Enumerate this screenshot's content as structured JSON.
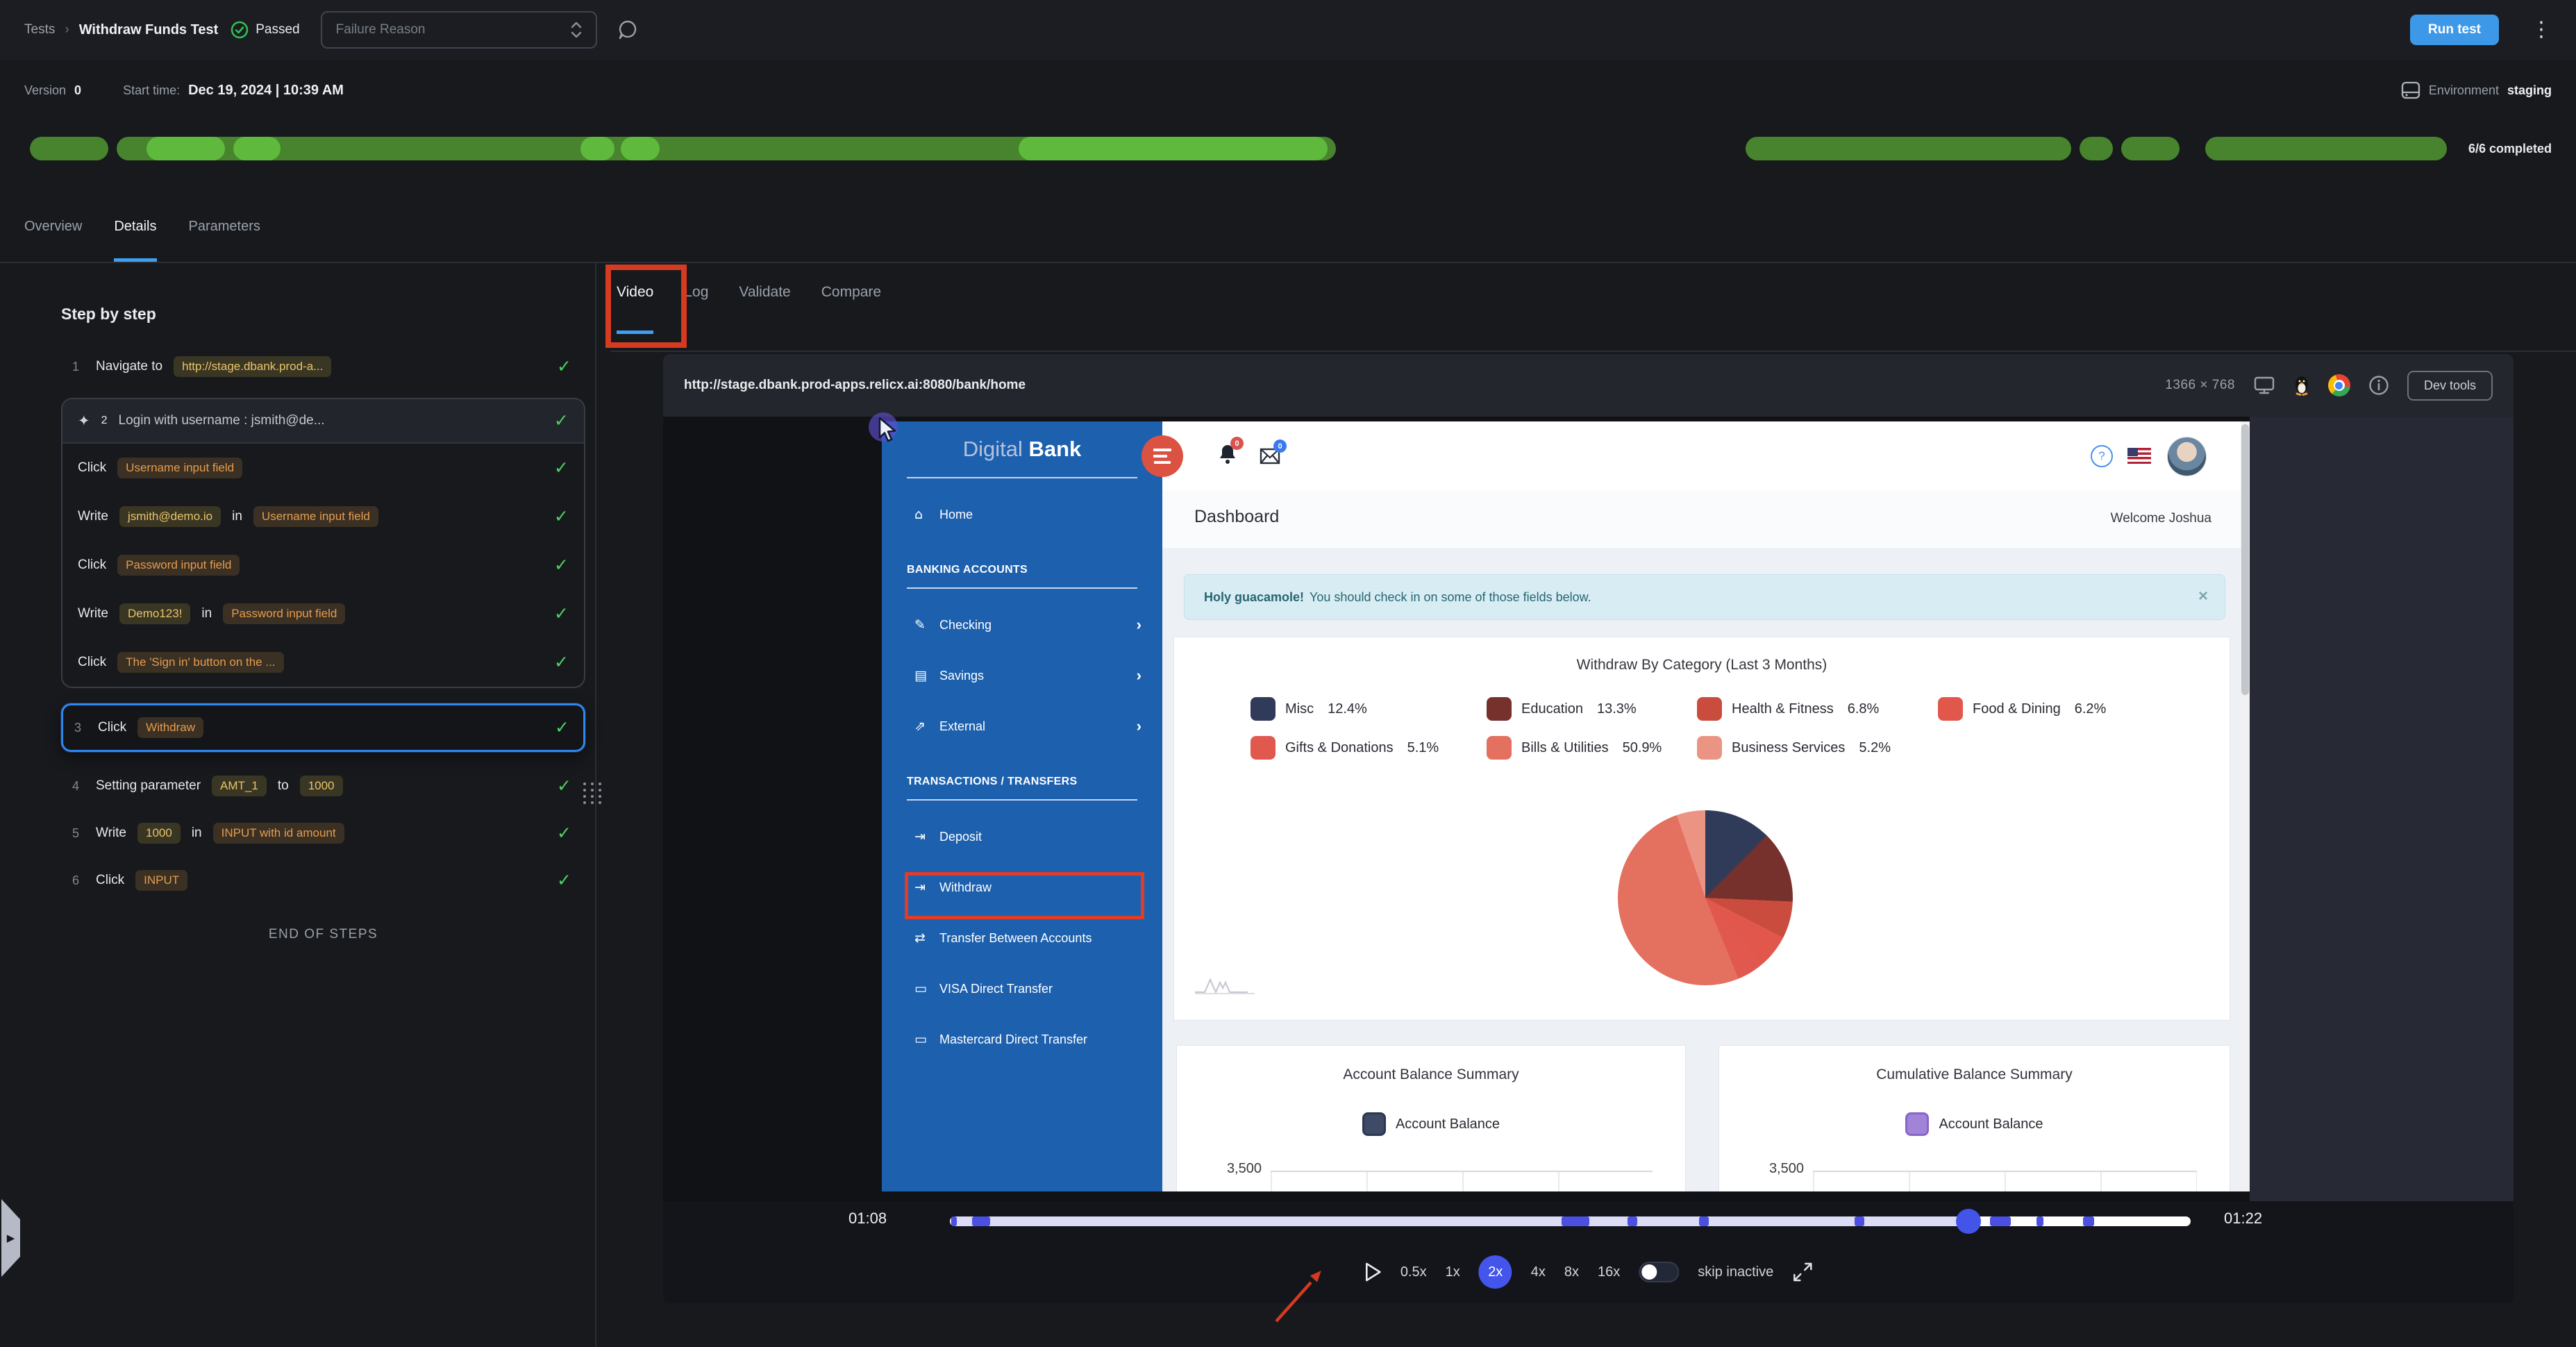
{
  "header": {
    "breadcrumb_root": "Tests",
    "breadcrumb_sep": "›",
    "title": "Withdraw Funds Test",
    "status": "Passed",
    "failure_reason_placeholder": "Failure Reason",
    "run_button": "Run test"
  },
  "meta": {
    "version_label": "Version",
    "version": "0",
    "start_label": "Start time:",
    "start_value": "Dec 19, 2024 | 10:39 AM",
    "environment_label": "Environment",
    "environment": "staging",
    "completed": "6/6 completed"
  },
  "progress": {
    "color_dark": "#47842d",
    "color_bright": "#5fb93c",
    "segments": [
      {
        "x": 0.0023,
        "w": 0.0323
      },
      {
        "x": 0.0381,
        "w": 0.502
      },
      {
        "x": 0.7087,
        "w": 0.134
      },
      {
        "x": 0.8462,
        "w": 0.0137
      },
      {
        "x": 0.8634,
        "w": 0.0241
      },
      {
        "x": 0.898,
        "w": 0.0994
      }
    ],
    "highlights": [
      {
        "x": 0.0503,
        "w": 0.0323
      },
      {
        "x": 0.086,
        "w": 0.0195
      },
      {
        "x": 0.2291,
        "w": 0.014
      },
      {
        "x": 0.2456,
        "w": 0.016
      },
      {
        "x": 0.4093,
        "w": 0.1273
      }
    ]
  },
  "main_tabs": [
    {
      "label": "Overview",
      "active": false
    },
    {
      "label": "Details",
      "active": true
    },
    {
      "label": "Parameters",
      "active": false
    }
  ],
  "steps_panel": {
    "heading": "Step by step",
    "end_label": "END OF STEPS",
    "steps": [
      {
        "type": "step",
        "num": "1",
        "check": true,
        "parts": [
          {
            "k": "t",
            "v": "Navigate to"
          },
          {
            "k": "y",
            "v": "http://stage.dbank.prod-a..."
          }
        ]
      },
      {
        "type": "group",
        "num": "2",
        "check": true,
        "header": "Login with username : jsmith@de...",
        "children": [
          {
            "check": true,
            "parts": [
              {
                "k": "t",
                "v": "Click"
              },
              {
                "k": "o",
                "v": "Username input field"
              }
            ]
          },
          {
            "check": true,
            "parts": [
              {
                "k": "t",
                "v": "Write"
              },
              {
                "k": "y",
                "v": "jsmith@demo.io"
              },
              {
                "k": "t",
                "v": "in"
              },
              {
                "k": "o",
                "v": "Username input field"
              }
            ]
          },
          {
            "check": true,
            "parts": [
              {
                "k": "t",
                "v": "Click"
              },
              {
                "k": "o",
                "v": "Password input field"
              }
            ]
          },
          {
            "check": true,
            "parts": [
              {
                "k": "t",
                "v": "Write"
              },
              {
                "k": "y",
                "v": "Demo123!"
              },
              {
                "k": "t",
                "v": "in"
              },
              {
                "k": "o",
                "v": "Password input field"
              }
            ]
          },
          {
            "check": true,
            "parts": [
              {
                "k": "t",
                "v": "Click"
              },
              {
                "k": "o",
                "v": "The 'Sign in' button on the ..."
              }
            ]
          }
        ]
      },
      {
        "type": "step",
        "num": "3",
        "selected": true,
        "check": true,
        "parts": [
          {
            "k": "t",
            "v": "Click"
          },
          {
            "k": "o",
            "v": "Withdraw"
          }
        ]
      },
      {
        "type": "step",
        "num": "4",
        "check": true,
        "parts": [
          {
            "k": "t",
            "v": "Setting parameter"
          },
          {
            "k": "y",
            "v": "AMT_1"
          },
          {
            "k": "t",
            "v": "to"
          },
          {
            "k": "y",
            "v": "1000"
          }
        ]
      },
      {
        "type": "step",
        "num": "5",
        "check": true,
        "parts": [
          {
            "k": "t",
            "v": "Write"
          },
          {
            "k": "y",
            "v": "1000"
          },
          {
            "k": "t",
            "v": "in"
          },
          {
            "k": "o",
            "v": "INPUT with id amount"
          }
        ]
      },
      {
        "type": "step",
        "num": "6",
        "check": true,
        "parts": [
          {
            "k": "t",
            "v": "Click"
          },
          {
            "k": "o",
            "v": "INPUT"
          }
        ]
      }
    ]
  },
  "video_panel": {
    "tabs": [
      {
        "label": "Video",
        "active": true
      },
      {
        "label": "Log",
        "active": false
      },
      {
        "label": "Validate",
        "active": false
      },
      {
        "label": "Compare",
        "active": false
      }
    ],
    "url": "http://stage.dbank.prod-apps.relicx.ai:8080/bank/home",
    "resolution": "1366 × 768",
    "devtools": "Dev tools"
  },
  "player": {
    "current_time": "01:08",
    "total_time": "01:22",
    "playhead_pos": 0.821,
    "markers": [
      {
        "pos": 0.001,
        "w": 8
      },
      {
        "pos": 0.018,
        "w": 26
      },
      {
        "pos": 0.493,
        "w": 40
      },
      {
        "pos": 0.546,
        "w": 14
      },
      {
        "pos": 0.604,
        "w": 14
      },
      {
        "pos": 0.729,
        "w": 14
      },
      {
        "pos": 0.838,
        "w": 30
      },
      {
        "pos": 0.876,
        "w": 10
      },
      {
        "pos": 0.913,
        "w": 16
      }
    ],
    "speeds": [
      "0.5x",
      "1x",
      "2x",
      "4x",
      "8x",
      "16x"
    ],
    "active_speed": "2x",
    "skip_label": "skip inactive"
  },
  "bank_app": {
    "logo_light": "Digital",
    "logo_bold": "Bank",
    "nav": [
      {
        "type": "item",
        "icon": "home-icon",
        "glyph": "⌂",
        "label": "Home"
      },
      {
        "type": "section",
        "label": "BANKING ACCOUNTS"
      },
      {
        "type": "item",
        "icon": "edit-icon",
        "glyph": "✎",
        "label": "Checking",
        "chevron": true
      },
      {
        "type": "item",
        "icon": "money-icon",
        "glyph": "▤",
        "label": "Savings",
        "chevron": true
      },
      {
        "type": "item",
        "icon": "external-link-icon",
        "glyph": "⇗",
        "label": "External",
        "chevron": true
      },
      {
        "type": "section",
        "label": "TRANSACTIONS / TRANSFERS"
      },
      {
        "type": "item",
        "icon": "deposit-icon",
        "glyph": "⇥",
        "label": "Deposit"
      },
      {
        "type": "item",
        "icon": "withdraw-icon",
        "glyph": "⇥",
        "label": "Withdraw",
        "highlight": true
      },
      {
        "type": "item",
        "icon": "transfer-icon",
        "glyph": "⇄",
        "label": "Transfer Between Accounts"
      },
      {
        "type": "item",
        "icon": "card-icon",
        "glyph": "▭",
        "label": "VISA Direct Transfer"
      },
      {
        "type": "item",
        "icon": "card-icon",
        "glyph": "▭",
        "label": "Mastercard Direct Transfer"
      }
    ],
    "topbar": {
      "bell_badge": "0",
      "mail_badge": "0",
      "help_glyph": "?"
    },
    "page_title": "Dashboard",
    "welcome": "Welcome Joshua",
    "alert": {
      "bold": "Holy guacamole!",
      "text": "You should check in on some of those fields below.",
      "close": "×"
    },
    "balance_cards": [
      {
        "title": "Account Balance Summary",
        "legend": "Account Balance",
        "color": "#3f4a66",
        "border": "#2c3850",
        "ytick": "3,500"
      },
      {
        "title": "Cumulative Balance Summary",
        "legend": "Account Balance",
        "color": "#a184d8",
        "border": "#8766c8",
        "ytick": "3,500"
      }
    ]
  },
  "chart_data": [
    {
      "type": "pie",
      "title": "Withdraw By Category (Last 3 Months)",
      "labels": [
        "Misc",
        "Education",
        "Health & Fitness",
        "Food & Dining",
        "Gifts & Donations",
        "Bills & Utilities",
        "Business Services"
      ],
      "values": [
        12.4,
        13.3,
        6.8,
        6.2,
        5.1,
        50.9,
        5.2
      ],
      "value_labels": [
        "12.4%",
        "13.3%",
        "6.8%",
        "6.2%",
        "5.1%",
        "50.9%",
        "5.2%"
      ],
      "colors": [
        "#2f3b59",
        "#77312c",
        "#c94c3f",
        "#e2574c",
        "#e0584e",
        "#e4705f",
        "#ec9484"
      ],
      "legend_position": "top"
    },
    {
      "type": "bar",
      "title": "Account Balance Summary",
      "series": [
        {
          "name": "Account Balance",
          "values": []
        }
      ],
      "ylim_ticks_visible": [
        "3,500"
      ],
      "grid": true
    },
    {
      "type": "bar",
      "title": "Cumulative Balance Summary",
      "series": [
        {
          "name": "Account Balance",
          "values": []
        }
      ],
      "ylim_ticks_visible": [
        "3,500"
      ],
      "grid": true
    }
  ]
}
